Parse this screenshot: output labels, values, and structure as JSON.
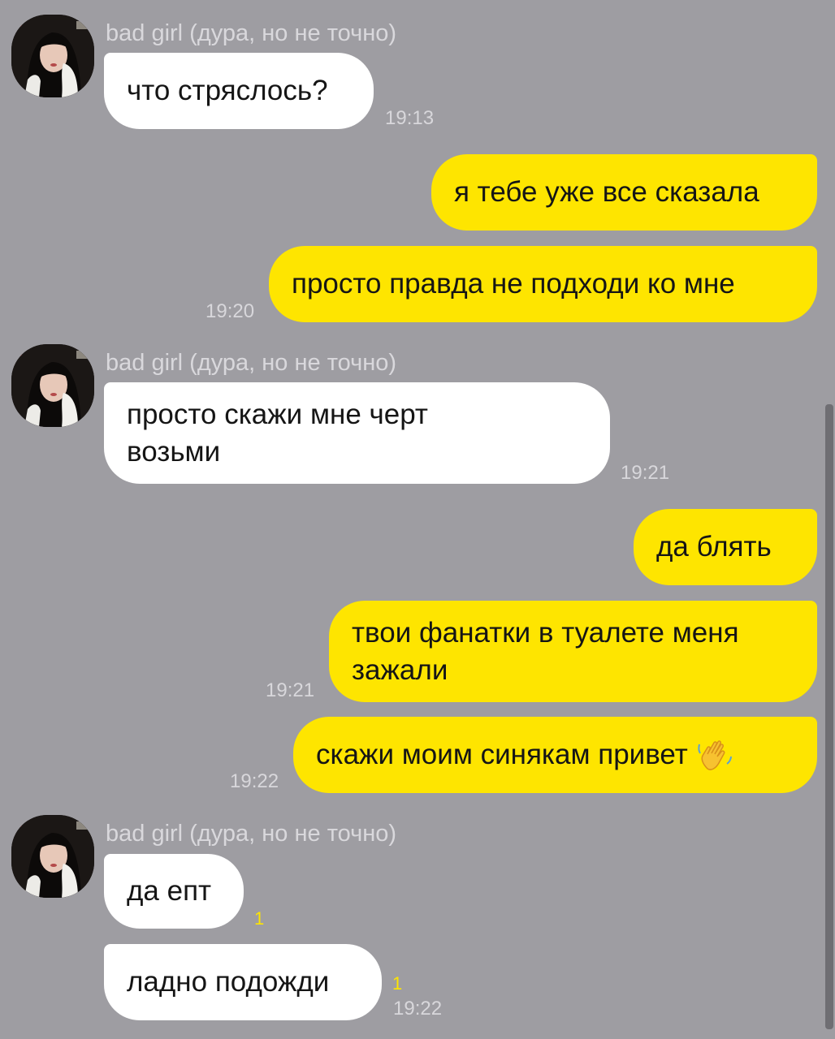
{
  "chat": {
    "sender_name": "bad girl (дура, но не точно)",
    "messages": [
      {
        "text": "что стряслось?",
        "time": "19:13"
      },
      {
        "text": "я тебе уже все сказала"
      },
      {
        "text": "просто правда не подходи ко мне",
        "time": "19:20"
      },
      {
        "text": "просто скажи мне черт возьми",
        "time": "19:21"
      },
      {
        "text": "да блять"
      },
      {
        "text": "твои фанатки в туалете меня зажали",
        "time": "19:21"
      },
      {
        "text": "скажи моим синякам привет",
        "time": "19:22"
      },
      {
        "text": "да епт",
        "unread": "1"
      },
      {
        "text": "ладно подожди",
        "unread": "1",
        "time": "19:22"
      }
    ]
  },
  "icons": {
    "avatar": "avatar-photo",
    "wave": "waving-hand-icon"
  },
  "colors": {
    "background": "#9e9da2",
    "outgoing_bubble": "#fee500",
    "incoming_bubble": "#ffffff",
    "unread_count": "#fee500"
  }
}
